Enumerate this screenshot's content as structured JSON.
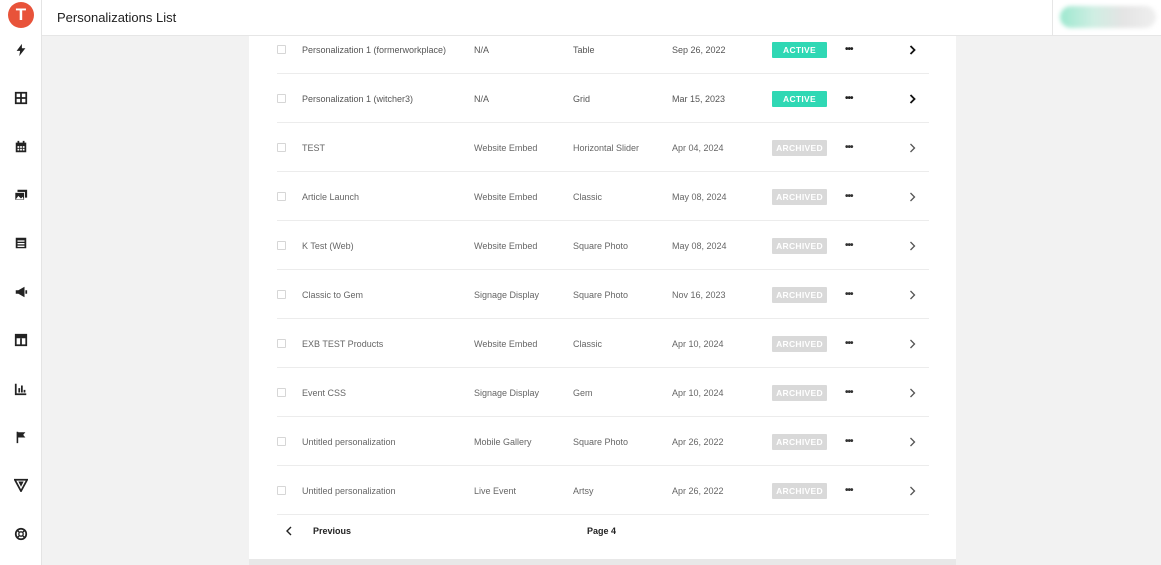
{
  "app": {
    "logo_letter": "T"
  },
  "header": {
    "title": "Personalizations List"
  },
  "sidebar": {
    "icons": [
      "lightning-icon",
      "grid-icon",
      "calendar-icon",
      "gallery-icon",
      "list-icon",
      "megaphone-icon",
      "layout-icon",
      "chart-icon",
      "flag-icon",
      "triangle-logo-icon",
      "help-icon"
    ]
  },
  "colors": {
    "active_badge": "#2fd8b4",
    "archived_badge": "#d9d9d9",
    "logo": "#e8533a"
  },
  "rows": [
    {
      "name": "Personalization 1 (formerworkplace)",
      "type": "N/A",
      "layout": "Table",
      "date": "Sep 26, 2022",
      "status": "ACTIVE"
    },
    {
      "name": "Personalization 1 (witcher3)",
      "type": "N/A",
      "layout": "Grid",
      "date": "Mar 15, 2023",
      "status": "ACTIVE"
    },
    {
      "name": "TEST",
      "type": "Website Embed",
      "layout": "Horizontal Slider",
      "date": "Apr 04, 2024",
      "status": "ARCHIVED"
    },
    {
      "name": "Article Launch",
      "type": "Website Embed",
      "layout": "Classic",
      "date": "May 08, 2024",
      "status": "ARCHIVED"
    },
    {
      "name": "K Test (Web)",
      "type": "Website Embed",
      "layout": "Square Photo",
      "date": "May 08, 2024",
      "status": "ARCHIVED"
    },
    {
      "name": "Classic to Gem",
      "type": "Signage Display",
      "layout": "Square Photo",
      "date": "Nov 16, 2023",
      "status": "ARCHIVED"
    },
    {
      "name": "EXB TEST Products",
      "type": "Website Embed",
      "layout": "Classic",
      "date": "Apr 10, 2024",
      "status": "ARCHIVED"
    },
    {
      "name": "Event CSS",
      "type": "Signage Display",
      "layout": "Gem",
      "date": "Apr 10, 2024",
      "status": "ARCHIVED"
    },
    {
      "name": "Untitled personalization",
      "type": "Mobile Gallery",
      "layout": "Square Photo",
      "date": "Apr 26, 2022",
      "status": "ARCHIVED"
    },
    {
      "name": "Untitled personalization",
      "type": "Live Event",
      "layout": "Artsy",
      "date": "Apr 26, 2022",
      "status": "ARCHIVED"
    }
  ],
  "row_actions": {
    "more": "•••"
  },
  "pagination": {
    "previous_label": "Previous",
    "page_label": "Page 4"
  }
}
